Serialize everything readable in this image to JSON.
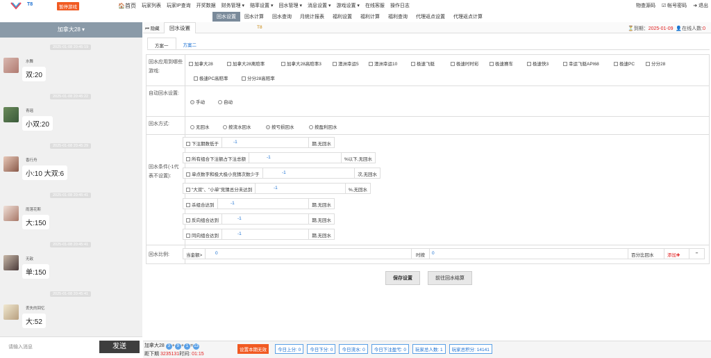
{
  "app": {
    "logo_text": "T8",
    "stop_badge": "暂停游戏"
  },
  "topnav": [
    {
      "label": "🏠首页"
    },
    {
      "label": "玩家列表"
    },
    {
      "label": "玩家IP查询"
    },
    {
      "label": "开奖数据"
    },
    {
      "label": "财务管理 ▾"
    },
    {
      "label": "赔率设置 ▾"
    },
    {
      "label": "回水管理 ▾"
    },
    {
      "label": "消息设置 ▾"
    },
    {
      "label": "游戏设置 ▾"
    },
    {
      "label": "在线客服"
    },
    {
      "label": "操作日志"
    }
  ],
  "topright": [
    "物查源码",
    "☑ 帐号密码",
    "➜ 退出"
  ],
  "subnav": [
    {
      "label": "回水设置",
      "active": true
    },
    {
      "label": "回水计算"
    },
    {
      "label": "回水查询"
    },
    {
      "label": "月统计报表"
    },
    {
      "label": "福利设置"
    },
    {
      "label": "福利计算"
    },
    {
      "label": "福利查询"
    },
    {
      "label": "代理返点设置"
    },
    {
      "label": "代理返点计算"
    }
  ],
  "left": {
    "header": "加拿大28 ▾",
    "messages": [
      {
        "time": "2025-01-08 20:45:19",
        "name": "水舞",
        "text": "双:20"
      },
      {
        "time": "2025-01-08 20:45:22",
        "name": "青瑶",
        "text": "小双:20"
      },
      {
        "time": "2025-01-08 20:45:29",
        "name": "香行舟",
        "text": "小:10 大双:6"
      },
      {
        "time": "2025-01-08 20:45:41",
        "name": "雨落花斯",
        "text": "大:150"
      },
      {
        "time": "2025-01-08 20:45:41",
        "name": "无敌",
        "text": "单:150"
      },
      {
        "time": "2025-01-08 20:45:41",
        "name": "丢失的回忆",
        "text": "大:52"
      }
    ],
    "input_placeholder": "请输入消息",
    "send_label": "发送"
  },
  "tabbar": {
    "back_label": "⏮ 隐藏",
    "tab_label": "回水设置",
    "mid_label": "T8",
    "expiry_label": "⏳到期：",
    "expiry_date": "2025-01-09",
    "online_label": "👤在线人数:",
    "online_count": "0"
  },
  "schemes": [
    "方案一",
    "方案二"
  ],
  "form": {
    "apply_label": "回水应用到哪些游戏:",
    "games_row1": [
      "加拿大28",
      "加拿大28离赔率",
      "加拿大28高赔率3",
      "澳洲幸运5",
      "澳洲幸运10",
      "极速飞艇",
      "极速时时彩",
      "极速赛车",
      "极速快3",
      "幸运飞艇API68",
      "极速PC",
      "分分28"
    ],
    "games_row2": [
      "极速PC高赔率",
      "分分28高赔率"
    ],
    "auto_label": "自动回水设置:",
    "auto_options": [
      {
        "label": "手动",
        "checked": true
      },
      {
        "label": "自动",
        "checked": false
      }
    ],
    "mode_label": "回水方式:",
    "mode_options": [
      {
        "label": "无回水",
        "checked": false
      },
      {
        "label": "按流水回水",
        "checked": false
      },
      {
        "label": "按亏损回水",
        "checked": true
      },
      {
        "label": "按盈利回水",
        "checked": false
      }
    ],
    "cond_label": "回水条件(-1代表不设置):",
    "conditions": [
      {
        "label": "下注期数低于",
        "value": "-1",
        "suffix": "期,无回水"
      },
      {
        "label": "所有组合下注额占下注总额",
        "value": "-1",
        "suffix": "%以下,无回水"
      },
      {
        "label": "单点数字和极大极小竞猜次数少于",
        "value": "-1",
        "suffix": "次,无回水"
      },
      {
        "label": "\"大双\"、\"小单\"竞猜总分未达到",
        "value": "-1",
        "suffix": "%,无回水"
      },
      {
        "label": "杀组合达到",
        "value": "-1",
        "suffix": "期,无回水"
      },
      {
        "label": "反向组合达到",
        "value": "-1",
        "suffix": "期,无回水"
      },
      {
        "label": "同向组合达到",
        "value": "-1",
        "suffix": "期,无回水"
      }
    ],
    "ratio_label": "回水比例:",
    "ratio": {
      "amount_label": "当金额>",
      "amount_value": "0",
      "mid_label": "时按",
      "pct_value": "0",
      "pct_label": "百分比回水",
      "add_label": "添加✚",
      "minus_label": "−"
    },
    "save_label": "保存设置",
    "goto_label": "前往回水结算"
  },
  "footer": {
    "game": "加拿大28",
    "balls": [
      "3",
      "9",
      "1"
    ],
    "result": "13",
    "dist_label": "距下期",
    "period": "3235131",
    "time_label": "时间:",
    "time": "01:15",
    "set_label": "设置本期无效",
    "stats": [
      "今日上分: 0",
      "今日下分: 0",
      "今日流水: 0",
      "今日下注盈亏: 0",
      "玩家总人数: 1",
      "玩家总积分: 14141"
    ]
  },
  "colors": {
    "accent": "#1a6fd1",
    "stop": "#f15a22",
    "sidebar_head": "#8a9aa8",
    "send": "#3e3e3e"
  }
}
